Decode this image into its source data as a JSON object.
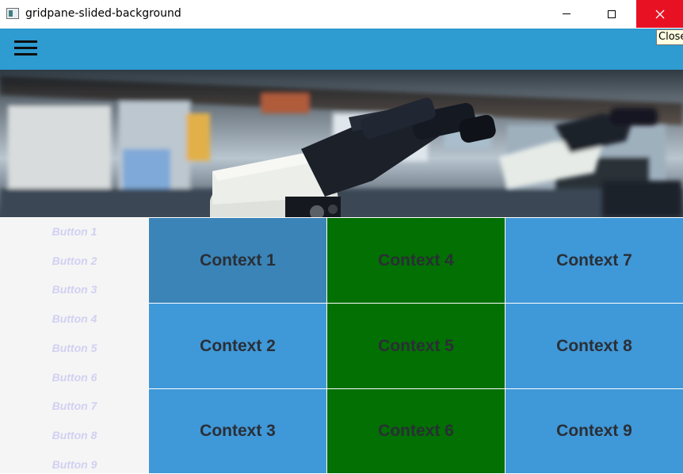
{
  "window": {
    "title": "gridpane-slided-background",
    "close_tooltip": "Close"
  },
  "colors": {
    "appbar": "#2e9bd1",
    "cell_selected": "#3a84b8",
    "cell_blue": "#3f98d8",
    "cell_green": "#027002",
    "sidebar_bg": "#f5f5f5",
    "sidebar_text": "#d1d0f2",
    "close_red": "#e81123"
  },
  "appbar": {
    "menu_icon": "hamburger-icon"
  },
  "sidebar": {
    "buttons": [
      "Button 1",
      "Button 2",
      "Button 3",
      "Button 4",
      "Button 5",
      "Button 6",
      "Button 7",
      "Button 8",
      "Button 9"
    ]
  },
  "grid": {
    "cells": [
      {
        "label": "Context 1",
        "color": "selected"
      },
      {
        "label": "Context 2",
        "color": "blue"
      },
      {
        "label": "Context 3",
        "color": "blue"
      },
      {
        "label": "Context 4",
        "color": "green"
      },
      {
        "label": "Context 5",
        "color": "green"
      },
      {
        "label": "Context 6",
        "color": "green"
      },
      {
        "label": "Context 7",
        "color": "blue"
      },
      {
        "label": "Context 8",
        "color": "blue"
      },
      {
        "label": "Context 9",
        "color": "blue"
      }
    ]
  }
}
